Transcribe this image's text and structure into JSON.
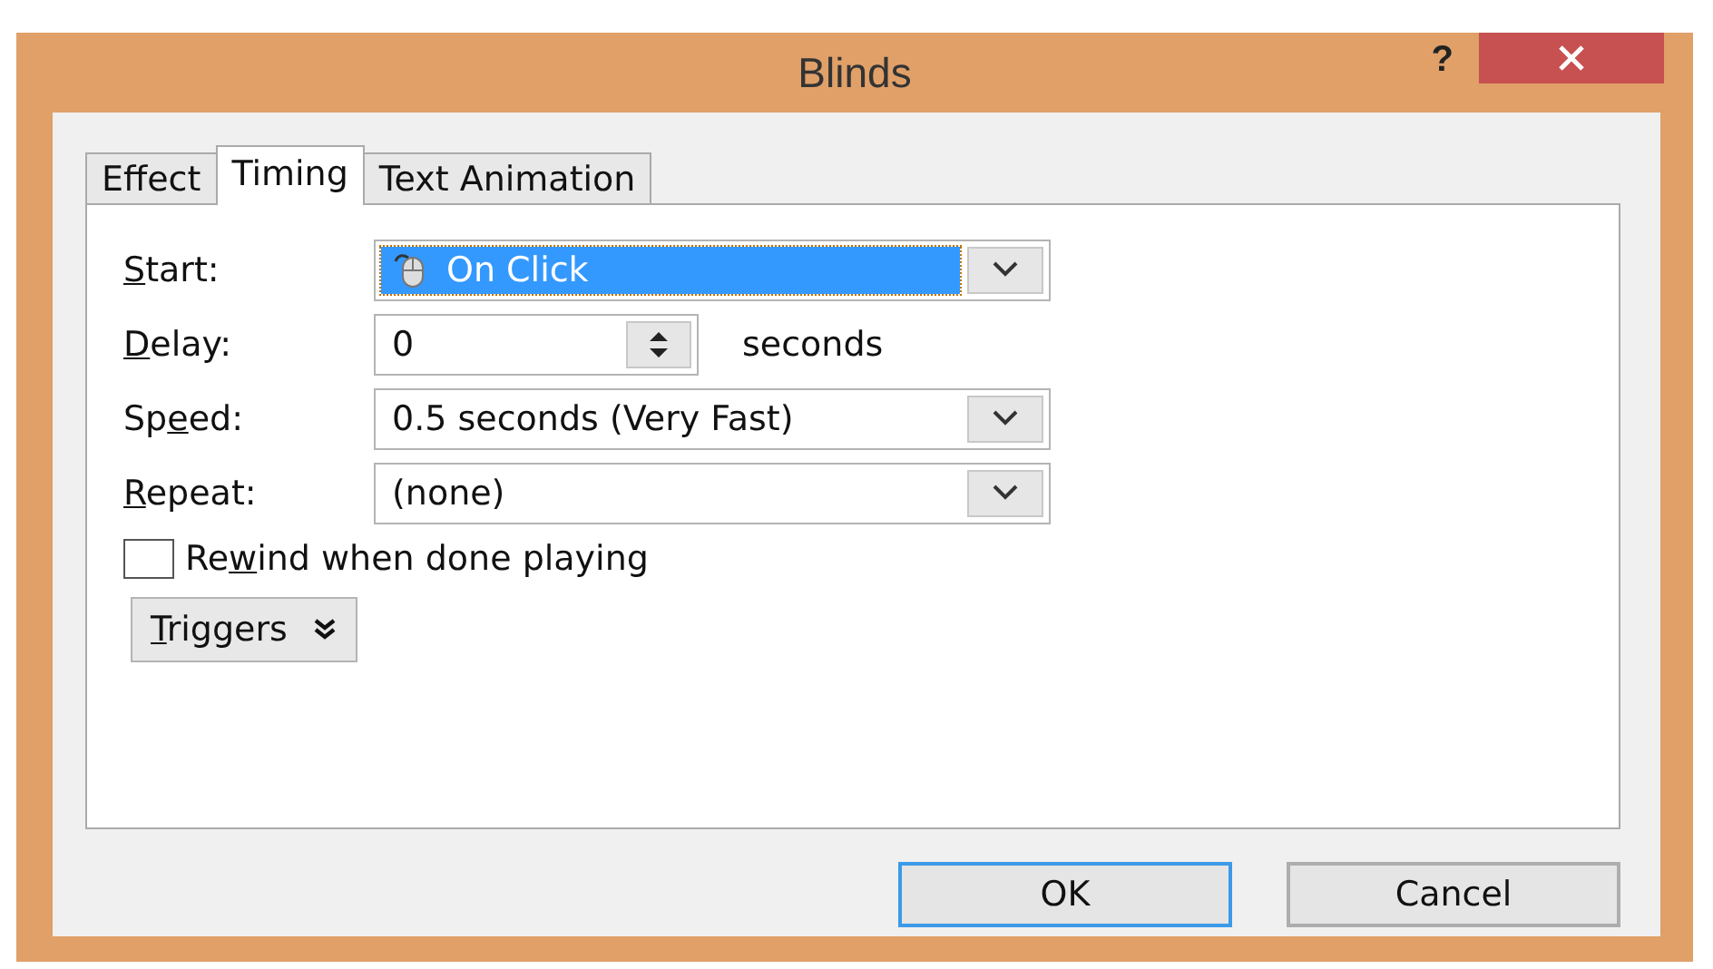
{
  "window": {
    "title": "Blinds",
    "help": "?"
  },
  "tabs": [
    {
      "label": "Effect",
      "selected": false
    },
    {
      "label": "Timing",
      "selected": true
    },
    {
      "label": "Text Animation",
      "selected": false
    }
  ],
  "fields": [
    {
      "kind": "combo",
      "label": {
        "key": "S",
        "rest": "tart:"
      },
      "value": "On Click",
      "focused": true
    },
    {
      "kind": "spin",
      "label": {
        "key": "D",
        "rest": "elay:"
      },
      "value": "0",
      "unit": "seconds"
    },
    {
      "kind": "combo",
      "label": {
        "before": "Sp",
        "key": "e",
        "rest": "ed:"
      },
      "value": "0.5 seconds (Very Fast)",
      "focused": false
    },
    {
      "kind": "combo",
      "label": {
        "key": "R",
        "rest": "epeat:"
      },
      "value": "(none)",
      "focused": false
    }
  ],
  "rewind": {
    "label": {
      "before": "Re",
      "key": "w",
      "rest": "ind when done playing"
    },
    "checked": false
  },
  "triggers": {
    "label": {
      "key": "T",
      "rest": "riggers"
    }
  },
  "buttons": [
    {
      "label": "OK",
      "default": true
    },
    {
      "label": "Cancel",
      "default": false
    }
  ]
}
